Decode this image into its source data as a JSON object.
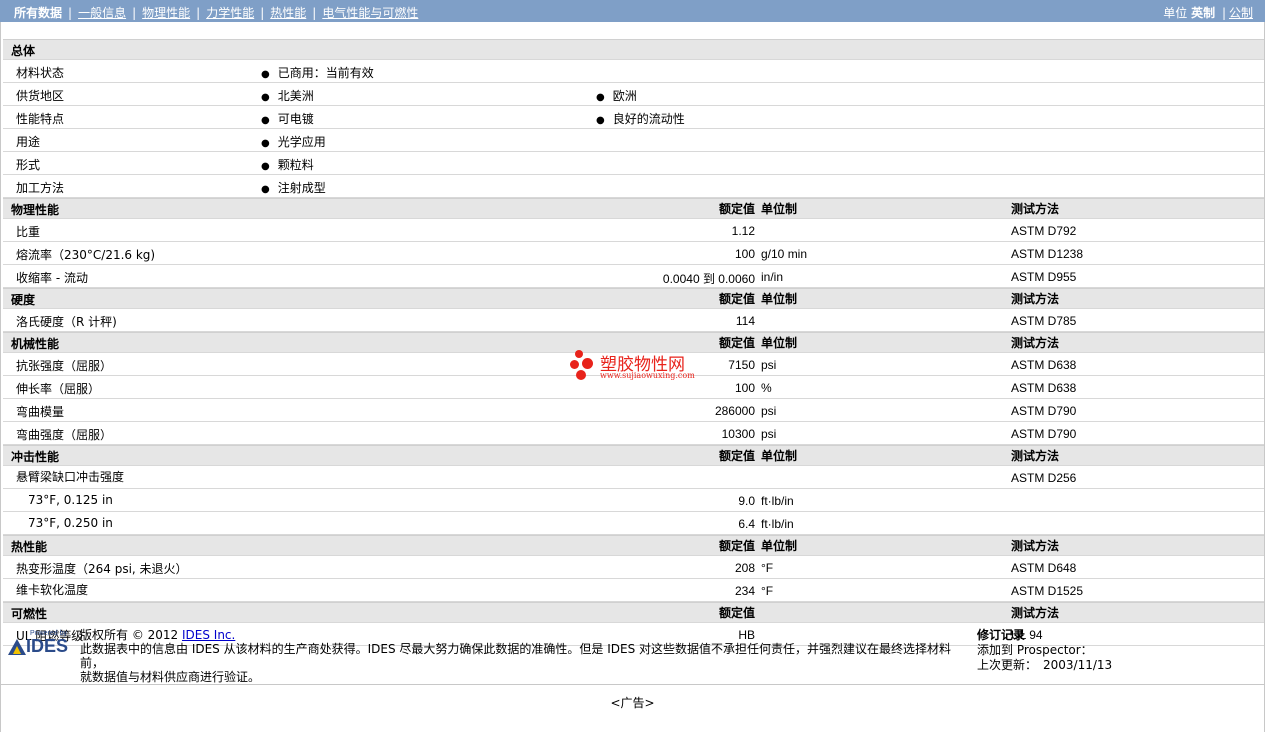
{
  "nav": {
    "tabs": [
      "所有数据",
      "一般信息",
      "物理性能",
      "力学性能",
      "热性能",
      "电气性能与可燃性"
    ],
    "units_label": "单位",
    "unit_current": "英制",
    "unit_other": "公制"
  },
  "sections": {
    "general": {
      "title": "总体",
      "rows": [
        {
          "label": "材料状态",
          "items": [
            "已商用：当前有效"
          ]
        },
        {
          "label": "供货地区",
          "items": [
            "北美洲",
            "欧洲"
          ]
        },
        {
          "label": "性能特点",
          "items": [
            "可电镀",
            "良好的流动性"
          ]
        },
        {
          "label": "用途",
          "items": [
            "光学应用"
          ]
        },
        {
          "label": "形式",
          "items": [
            "颗粒料"
          ]
        },
        {
          "label": "加工方法",
          "items": [
            "注射成型"
          ]
        }
      ]
    },
    "columns": {
      "value": "额定值",
      "unit": "单位制",
      "test": "测试方法"
    },
    "physical": {
      "title": "物理性能",
      "rows": [
        {
          "label": "比重",
          "value": "1.12",
          "unit": "",
          "test": "ASTM D792"
        },
        {
          "label": "熔流率（230°C/21.6 kg)",
          "value": "100",
          "unit": "g/10 min",
          "test": "ASTM D1238"
        },
        {
          "label": "收缩率 - 流动",
          "value": "0.0040 到  0.0060",
          "unit": "in/in",
          "test": "ASTM D955"
        }
      ]
    },
    "hardness": {
      "title": "硬度",
      "rows": [
        {
          "label": "洛氏硬度（R 计秤)",
          "value": "114",
          "unit": "",
          "test": "ASTM D785"
        }
      ]
    },
    "mechanical": {
      "title": "机械性能",
      "rows": [
        {
          "label": "抗张强度（屈服）",
          "value": "7150",
          "unit": "psi",
          "test": "ASTM D638"
        },
        {
          "label": "伸长率（屈服）",
          "value": "100",
          "unit": "%",
          "test": "ASTM D638"
        },
        {
          "label": "弯曲模量",
          "value": "286000",
          "unit": "psi",
          "test": "ASTM D790"
        },
        {
          "label": "弯曲强度（屈服）",
          "value": "10300",
          "unit": "psi",
          "test": "ASTM D790"
        }
      ]
    },
    "impact": {
      "title": "冲击性能",
      "rows": [
        {
          "label": "悬臂梁缺口冲击强度",
          "value": "",
          "unit": "",
          "test": "ASTM D256"
        },
        {
          "label": "73°F, 0.125 in",
          "value": "9.0",
          "unit": "ft·lb/in",
          "test": ""
        },
        {
          "label": "73°F, 0.250 in",
          "value": "6.4",
          "unit": "ft·lb/in",
          "test": ""
        }
      ]
    },
    "thermal": {
      "title": "热性能",
      "rows": [
        {
          "label": "热变形温度（264 psi, 未退火）",
          "value": "208",
          "unit": "°F",
          "test": "ASTM D648"
        },
        {
          "label": "维卡软化温度",
          "value": "234",
          "unit": "°F",
          "test": "ASTM D1525"
        }
      ]
    },
    "flammability": {
      "title": "可燃性",
      "rows": [
        {
          "label": "UL 阻燃等级",
          "value": "HB",
          "unit": "",
          "test": "UL 94"
        }
      ]
    }
  },
  "watermark": {
    "text": "塑胶物性网",
    "url": "www.sujiaowuxing.com"
  },
  "footer": {
    "logo_small": "Powered by",
    "logo_text": "IDES",
    "copyright_prefix": "版权所有  © 2012 ",
    "copyright_link": "IDES Inc.",
    "disclaimer_1": "此数据表中的信息由  IDES 从该材料的生产商处获得。IDES 尽最大努力确保此数据的准确性。但是  IDES 对这些数据值不承担任何责任，并强烈建议在最终选择材料前，",
    "disclaimer_2": "就数据值与材料供应商进行验证。",
    "revision_title": "修订记录",
    "added_label": "添加到  Prospector：",
    "updated_label": "上次更新：",
    "updated_value": "2003/11/13"
  },
  "ad_label": "<广告>"
}
